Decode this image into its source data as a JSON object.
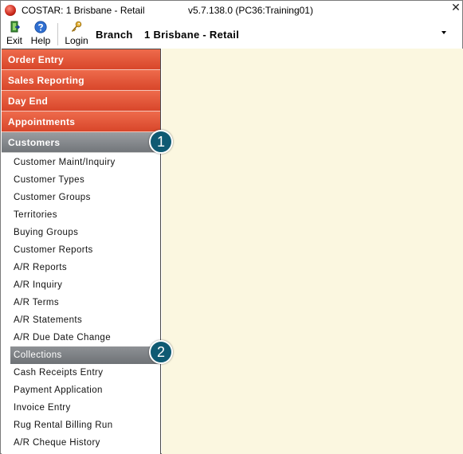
{
  "title_bar": {
    "app_name": "COSTAR:  1 Brisbane - Retail",
    "version": "v5.7.138.0  (PC36:Training01)",
    "close_glyph": "✕"
  },
  "toolbar": {
    "exit_label": "Exit",
    "help_label": "Help",
    "login_label": "Login",
    "branch_label": "Branch",
    "branch_value": "1  Brisbane - Retail"
  },
  "sidebar": {
    "sections": [
      {
        "label": "Order Entry"
      },
      {
        "label": "Sales Reporting"
      },
      {
        "label": "Day End"
      },
      {
        "label": "Appointments"
      },
      {
        "label": "Customers"
      }
    ],
    "customers_items": [
      "Customer Maint/Inquiry",
      "Customer Types",
      "Customer Groups",
      "Territories",
      "Buying Groups",
      "Customer Reports",
      "A/R Reports",
      "A/R Inquiry",
      "A/R Terms",
      "A/R Statements",
      "A/R Due Date Change",
      "Collections",
      "Cash Receipts Entry",
      "Payment Application",
      "Invoice Entry",
      "Rug Rental Billing Run",
      "A/R Cheque History"
    ],
    "selected_item": "Collections"
  },
  "callouts": [
    "1",
    "2"
  ],
  "colors": {
    "section_orange": "#e0553a",
    "section_gray": "#7f8387",
    "content_bg": "#fbf7e0",
    "callout_bg": "#0f5a73"
  },
  "icons": {
    "exit": "exit-door-icon",
    "help": "help-question-icon",
    "login": "key-icon",
    "logo": "costar-logo-icon"
  }
}
